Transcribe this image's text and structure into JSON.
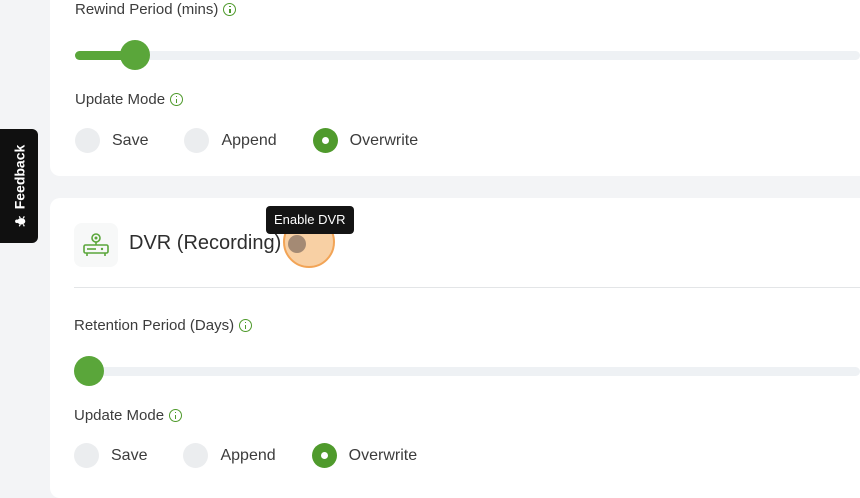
{
  "feedback": {
    "label": "Feedback"
  },
  "live_section": {
    "rewind": {
      "label": "Rewind Period (mins)",
      "value_fraction": 0.06
    },
    "update_mode": {
      "label": "Update Mode",
      "options": [
        "Save",
        "Append",
        "Overwrite"
      ],
      "selected": "Overwrite"
    }
  },
  "dvr_section": {
    "title": "DVR (Recording)",
    "tooltip": "Enable DVR",
    "toggle_enabled": false,
    "retention": {
      "label": "Retention Period (Days)",
      "value_fraction": 0
    },
    "update_mode": {
      "label": "Update Mode",
      "options": [
        "Save",
        "Append",
        "Overwrite"
      ],
      "selected": "Overwrite"
    }
  },
  "colors": {
    "accent": "#5aa63a",
    "focus_ring": "#f2a456"
  }
}
